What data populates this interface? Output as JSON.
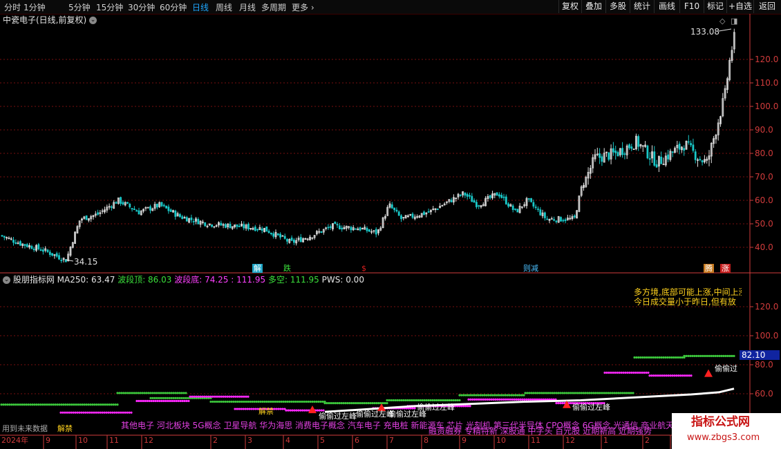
{
  "toolbar": {
    "periods": [
      "分时",
      "1分钟",
      "5分钟",
      "15分钟",
      "30分钟",
      "60分钟",
      "日线",
      "周线",
      "月线",
      "多周期",
      "更多"
    ],
    "active_period": "日线",
    "buttons": [
      "复权",
      "叠加",
      "多股",
      "统计",
      "画线",
      "F10",
      "标记",
      "+自选",
      "返回"
    ]
  },
  "main_chart": {
    "title": "中瓷电子(日线,前复权)",
    "high_label": "133.08",
    "low_label": "34.15",
    "y_ticks": [
      "120.0",
      "110.0",
      "100.0",
      "90.0",
      "80.0",
      "70.0",
      "60.0",
      "50.0",
      "40.0"
    ],
    "signals": [
      "解",
      "跌",
      "$",
      "则减",
      "腾",
      "涨"
    ],
    "colors": {
      "up": "#e0e0e0",
      "down": "#19c8c8",
      "grid": "#7a1010",
      "axis": "#d23c3c"
    }
  },
  "indicator": {
    "name": "股朋指标网",
    "ma250": "MA250: 63.47",
    "wave_top": "波段顶: 86.03",
    "wave_bottom": "波段底: 74.25",
    "wave_bottom_extra": ": 111.95",
    "long_short": "多空: 111.95",
    "pws": "PWS: 0.00",
    "y_ticks": [
      "120.0",
      "100.0",
      "80.0",
      "60.0"
    ],
    "value_tag": "82.10",
    "notes": [
      "多方境,底部可能上涨,中间上涨",
      "今日成交量小于昨日,但有放"
    ],
    "labels": [
      "偷偷过左峰",
      "偷偷过左峰",
      "偷偷过左峰",
      "偷偷过左峰",
      "偷偷过左峰",
      "偷偷过",
      "解禁",
      "解禁"
    ],
    "concepts_line1": "其他电子 河北板块 5G概念 卫星导航 华为海思 消费电子概念 汽车电子 充电桩 新能源车 芯片 光刻机 第三代半导体 CPO概念 6G概念 光通信 商业航天",
    "concepts_line2": "融资融券 专精特新 深股通 中字头 百元股 近期新高 近期强势",
    "future_data": "用到未来数据"
  },
  "x_axis": {
    "year_label": "2024年",
    "ticks": [
      "9",
      "10",
      "11",
      "12",
      "2",
      "3",
      "4",
      "5",
      "6",
      "7",
      "8",
      "9",
      "10",
      "11",
      "12",
      "1",
      "2",
      "3"
    ]
  },
  "watermark": {
    "title": "指标公式网",
    "url": "www.zbgs3.com"
  }
}
